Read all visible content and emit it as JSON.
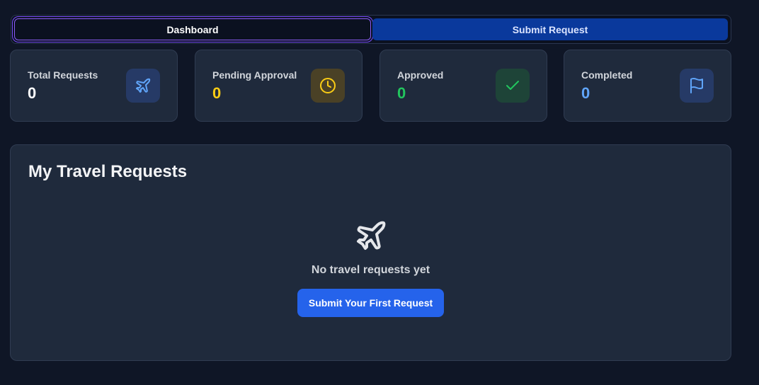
{
  "tabs": [
    {
      "label": "Dashboard",
      "active": true
    },
    {
      "label": "Submit Request",
      "active": false
    }
  ],
  "stats": [
    {
      "label": "Total Requests",
      "value": "0",
      "icon": "plane-icon",
      "value_color": "#ffffff",
      "icon_bg": "#263a66",
      "icon_color": "#60a5fa"
    },
    {
      "label": "Pending Approval",
      "value": "0",
      "icon": "clock-icon",
      "value_color": "#facc15",
      "icon_bg": "#4a4126",
      "icon_color": "#facc15"
    },
    {
      "label": "Approved",
      "value": "0",
      "icon": "check-icon",
      "value_color": "#22c55e",
      "icon_bg": "#1e4438",
      "icon_color": "#22c55e"
    },
    {
      "label": "Completed",
      "value": "0",
      "icon": "flag-icon",
      "value_color": "#60a5fa",
      "icon_bg": "#263a66",
      "icon_color": "#60a5fa"
    }
  ],
  "panel": {
    "title": "My Travel Requests",
    "empty_icon": "plane-icon",
    "empty_text": "No travel requests yet",
    "cta_label": "Submit Your First Request"
  },
  "colors": {
    "background": "#0f1626",
    "card": "#1f2a3c",
    "accent": "#2563eb",
    "active_tab_border": "#8b5cf6"
  }
}
